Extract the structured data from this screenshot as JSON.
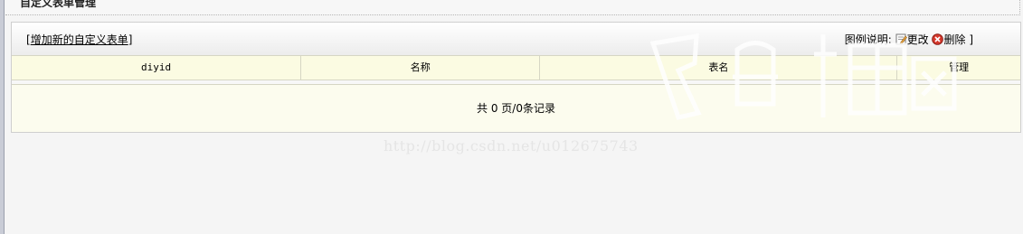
{
  "page": {
    "title": "自定义表单管理"
  },
  "toolbar": {
    "add_label": "增加新的自定义表单",
    "bracket_open": "[",
    "bracket_close": "]",
    "legend_label": "图例说明:",
    "edit_label": "更改",
    "delete_label": "删除",
    "legend_close": " ]"
  },
  "table": {
    "columns": [
      "diyid",
      "名称",
      "表名",
      "管理"
    ]
  },
  "pager": {
    "text": "共 0 页/0条记录"
  },
  "watermark": {
    "url": "http://blog.csdn.net/u012675743"
  },
  "icons": {
    "edit": "edit-icon",
    "delete": "delete-icon"
  }
}
